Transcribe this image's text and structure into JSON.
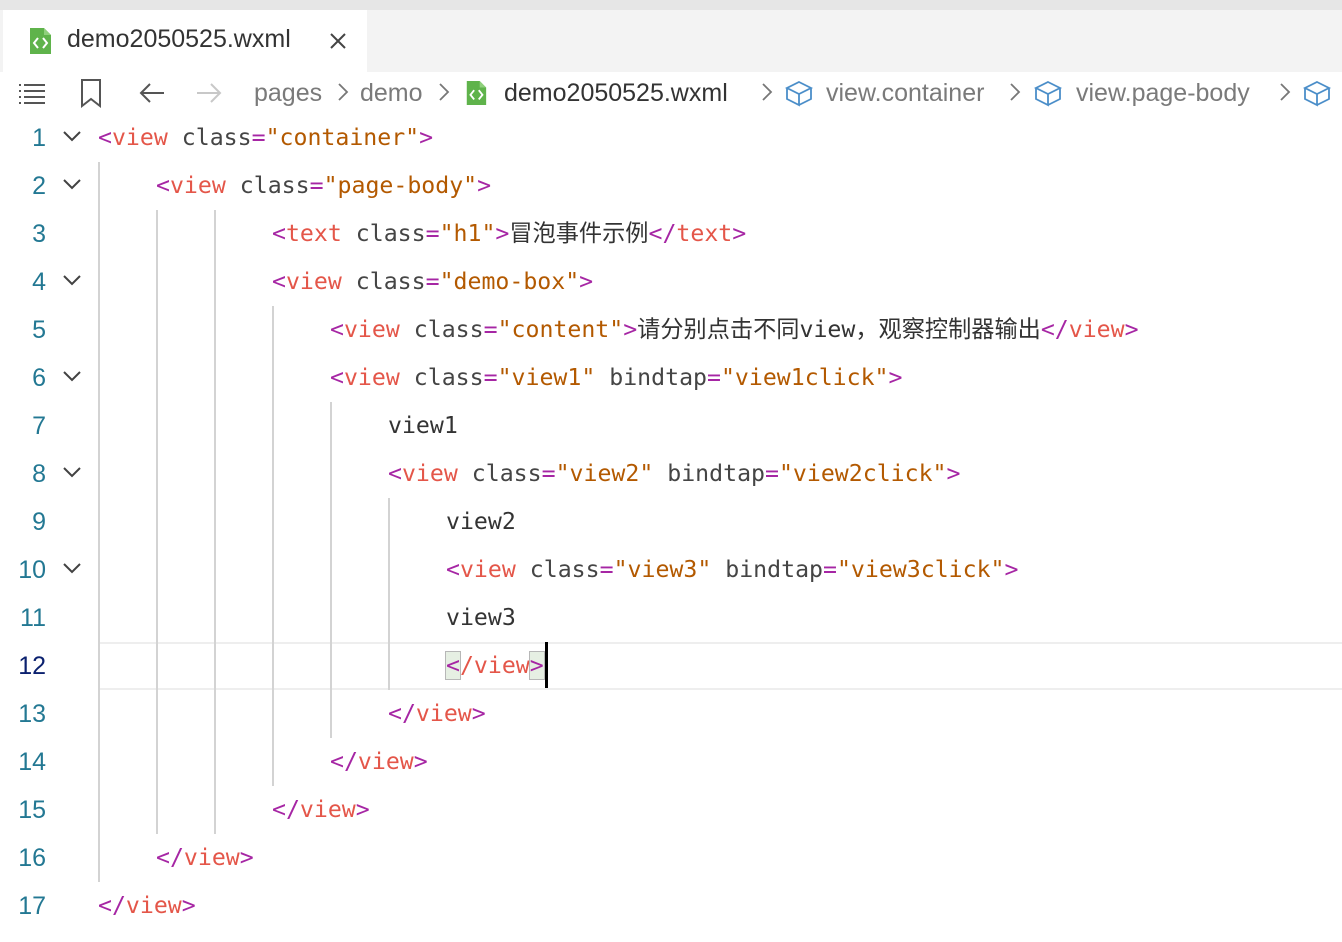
{
  "tab": {
    "label": "demo2050525.wxml",
    "file_icon": "wxml-file-icon",
    "close_icon": "close-icon"
  },
  "breadcrumbs": {
    "items": [
      "pages",
      "demo",
      "demo2050525.wxml",
      "view.container",
      "view.page-body"
    ],
    "icons": [
      "list-icon",
      "bookmark-icon",
      "arrow-left-icon",
      "arrow-right-icon"
    ]
  },
  "editor": {
    "current_line": 12,
    "lines": [
      {
        "n": "1",
        "fold": true
      },
      {
        "n": "2",
        "fold": true
      },
      {
        "n": "3",
        "fold": false
      },
      {
        "n": "4",
        "fold": true
      },
      {
        "n": "5",
        "fold": false
      },
      {
        "n": "6",
        "fold": true
      },
      {
        "n": "7",
        "fold": false
      },
      {
        "n": "8",
        "fold": true
      },
      {
        "n": "9",
        "fold": false
      },
      {
        "n": "10",
        "fold": true
      },
      {
        "n": "11",
        "fold": false
      },
      {
        "n": "12",
        "fold": false
      },
      {
        "n": "13",
        "fold": false
      },
      {
        "n": "14",
        "fold": false
      },
      {
        "n": "15",
        "fold": false
      },
      {
        "n": "16",
        "fold": false
      },
      {
        "n": "17",
        "fold": false
      }
    ],
    "tokens": {
      "l1": [
        "<",
        "view",
        " ",
        "class",
        "=",
        "\"container\"",
        ">"
      ],
      "l2": [
        "<",
        "view",
        " ",
        "class",
        "=",
        "\"page-body\"",
        ">"
      ],
      "l3": [
        "<",
        "text",
        " ",
        "class",
        "=",
        "\"h1\"",
        ">",
        "冒泡事件示例",
        "</",
        "text",
        ">"
      ],
      "l4": [
        "<",
        "view",
        " ",
        "class",
        "=",
        "\"demo-box\"",
        ">"
      ],
      "l5": [
        "<",
        "view",
        " ",
        "class",
        "=",
        "\"content\"",
        ">",
        "请分别点击不同view，观察控制器输出",
        "</",
        "view",
        ">"
      ],
      "l6": [
        "<",
        "view",
        " ",
        "class",
        "=",
        "\"view1\"",
        " ",
        "bindtap",
        "=",
        "\"view1click\"",
        ">"
      ],
      "l7": [
        "view1"
      ],
      "l8": [
        "<",
        "view",
        " ",
        "class",
        "=",
        "\"view2\"",
        " ",
        "bindtap",
        "=",
        "\"view2click\"",
        ">"
      ],
      "l9": [
        "view2"
      ],
      "l10": [
        "<",
        "view",
        " ",
        "class",
        "=",
        "\"view3\"",
        " ",
        "bindtap",
        "=",
        "\"view3click\"",
        ">"
      ],
      "l11": [
        "view3"
      ],
      "l12": [
        "<",
        "/view",
        ">"
      ],
      "l13": [
        "</",
        "view",
        ">"
      ],
      "l14": [
        "</",
        "view",
        ">"
      ],
      "l15": [
        "</",
        "view",
        ">"
      ],
      "l16": [
        "</",
        "view",
        ">"
      ],
      "l17": [
        "</",
        "view",
        ">"
      ]
    }
  },
  "colors": {
    "bracket": "#a626a4",
    "tag": "#e45649",
    "attribute": "#454545",
    "string": "#b35900",
    "line_number": "#237893"
  }
}
